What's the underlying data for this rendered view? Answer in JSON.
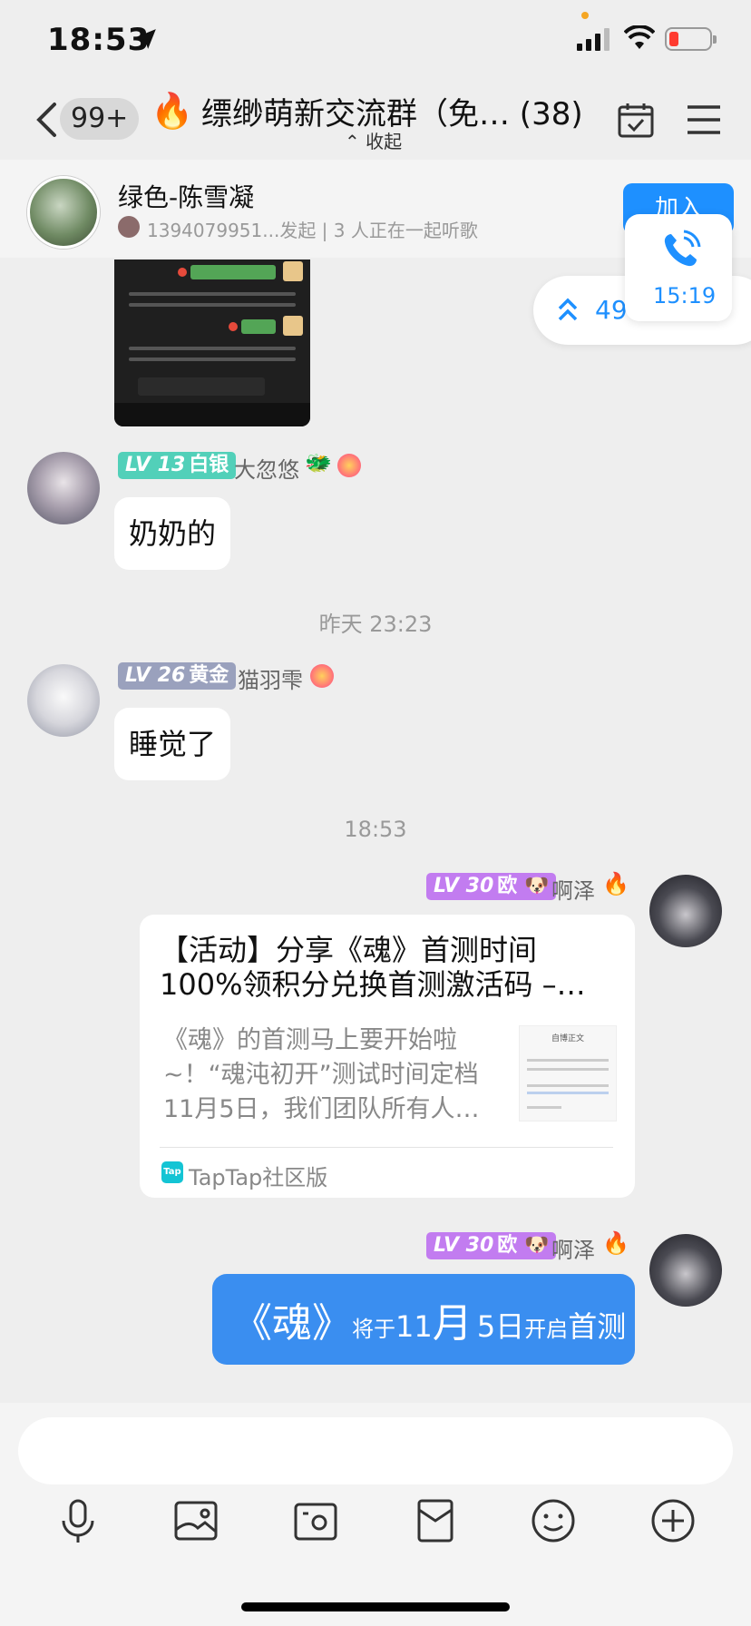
{
  "status_bar": {
    "time": "18:53"
  },
  "nav": {
    "unread_count": "99+",
    "group_title": "缥缈萌新交流群（免… (38)",
    "collapse_label": "收起"
  },
  "listen_banner": {
    "title": "绿色-陈雪凝",
    "subtitle": "1394079951...发起 | 3 人正在一起听歌",
    "join_label": "加入"
  },
  "call_widget": {
    "duration": "15:19"
  },
  "unread_pill": {
    "count_text": "49"
  },
  "screenshot_image": {
    "bubble1": "还是我家的驴子可爱",
    "bubble2": "略略略",
    "sys_text": "请开启了朋友验证，你还不是他（她）朋友。请先发送朋友验证请求，对方验证通过后，才能聊天。发送朋友验证"
  },
  "messages": [
    {
      "level": "LV 13",
      "tier": "白银",
      "nick": "大忽悠",
      "text": "奶奶的"
    },
    {
      "level": "LV 26",
      "tier": "黄金",
      "nick": "猫羽雫",
      "text": "睡觉了"
    },
    {
      "level": "LV 30",
      "tier": "欧",
      "nick": "啊泽"
    },
    {
      "level": "LV 30",
      "tier": "欧",
      "nick": "啊泽"
    }
  ],
  "timestamps": [
    "昨天 23:23",
    "18:53"
  ],
  "card": {
    "title": "【活动】分享《魂》首测时间100%领积分兑换首测激活码 –…",
    "desc": "《魂》的首测马上要开始啦~！“魂沌初开”测试时间定档11月5日，我们团队所有人…",
    "thumb_title": "自博正文",
    "source": "TapTap社区版"
  },
  "blue_bubble": {
    "p1": "《魂》",
    "p2": "将于",
    "p3": "11",
    "p4": "月",
    "p5": "5日",
    "p6": "开启",
    "p7": "首测"
  },
  "toolbar_icons": [
    "mic-icon",
    "image-icon",
    "camera-icon",
    "red-packet-icon",
    "emoji-icon",
    "plus-icon"
  ]
}
